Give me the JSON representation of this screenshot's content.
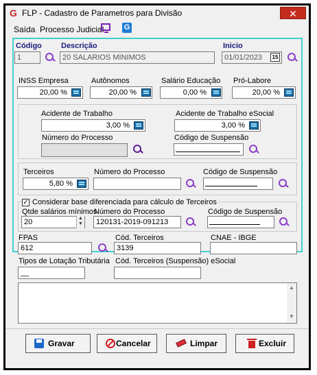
{
  "window": {
    "title": "FLP - Cadastro de Parametros para Divisão",
    "close_label": "✕"
  },
  "menu": {
    "items": [
      "Saída",
      "Processo Judicial"
    ]
  },
  "header": {
    "codigo_label": "Código",
    "codigo_value": "1",
    "descricao_label": "Descrição",
    "descricao_value": "20 SALARIOS MINIMOS",
    "inicio_label": "Inicio",
    "inicio_value": "01/01/2023",
    "calendar_label": "15"
  },
  "rates": {
    "inss_label": "INSS Empresa",
    "inss_value": "20,00 %",
    "autonomos_label": "Autônomos",
    "autonomos_value": "20,00 %",
    "salario_educacao_label": "Salário Educação",
    "salario_educacao_value": "0,00 %",
    "pro_labore_label": "Pró-Labore",
    "pro_labore_value": "20,00 %"
  },
  "acidente": {
    "acidente_label": "Acidente de Trabalho",
    "acidente_value": "3,00 %",
    "acidente_esocial_label": "Acidente de Trabalho eSocial",
    "acidente_esocial_value": "3,00 %",
    "numero_processo_label": "Número do Processo",
    "numero_processo_value": "",
    "codigo_suspensao_label": "Código de Suspensão",
    "codigo_suspensao_value": ""
  },
  "terceiros": {
    "terceiros_label": "Terceiros",
    "terceiros_value": "5,80 %",
    "numero_processo_label": "Número do Processo",
    "numero_processo_value": "",
    "codigo_suspensao_label": "Código de Suspensão",
    "codigo_suspensao_value": ""
  },
  "diferenciada": {
    "checkbox_label": "Considerar base diferenciada para cálculo de Terceiros",
    "checked": true,
    "check_glyph": "✓",
    "qtde_label": "Qtde salários mínimos",
    "qtde_value": "20",
    "numero_processo_label": "Número do Processo",
    "numero_processo_value": "120131-2019-091213",
    "codigo_suspensao_label": "Código de Suspensão",
    "codigo_suspensao_value": ""
  },
  "fpas": {
    "fpas_label": "FPAS",
    "fpas_value": "612",
    "cod_terceiros_label": "Cód. Terceiros",
    "cod_terceiros_value": "3139",
    "cnae_label": "CNAE - IBGE",
    "cnae_value": ""
  },
  "lotacao": {
    "tipos_label": "Tipos de Lotação Tributária",
    "tipos_value": "__",
    "cod_susp_label": "Cód. Terceiros (Suspensão) eSocial",
    "cod_susp_value": ""
  },
  "buttons": {
    "gravar": "Gravar",
    "cancelar": "Cancelar",
    "limpar": "Limpar",
    "excluir": "Excluir"
  },
  "colors": {
    "accent_border": "#40d0d0",
    "search_icon": "#8a3cc8",
    "close": "#c42b1c"
  }
}
